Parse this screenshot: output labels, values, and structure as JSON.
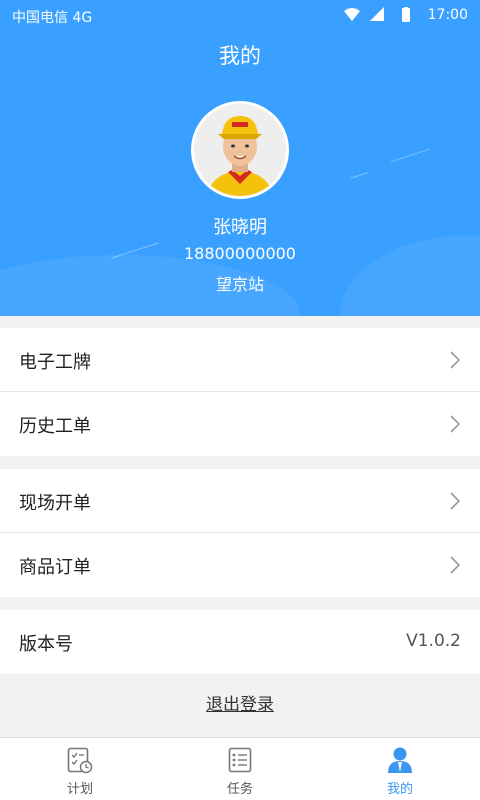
{
  "status_bar": {
    "carrier": "中国电信 4G",
    "time": "17:00"
  },
  "header": {
    "title": "我的",
    "user_name": "张晓明",
    "phone": "18800000000",
    "station": "望京站"
  },
  "menu_groups": [
    {
      "items": [
        {
          "label": "电子工牌"
        },
        {
          "label": "历史工单"
        }
      ]
    },
    {
      "items": [
        {
          "label": "现场开单"
        },
        {
          "label": "商品订单"
        }
      ]
    },
    {
      "items": [
        {
          "label": "版本号",
          "value": "V1.0.2"
        }
      ]
    }
  ],
  "logout_label": "退出登录",
  "tabs": [
    {
      "label": "计划",
      "icon": "plan-icon",
      "active": false
    },
    {
      "label": "任务",
      "icon": "task-icon",
      "active": false
    },
    {
      "label": "我的",
      "icon": "profile-icon",
      "active": true
    }
  ],
  "colors": {
    "header_bg": "#3aa0ff",
    "active_tab": "#3a96f0",
    "background": "#f2f2f2"
  }
}
